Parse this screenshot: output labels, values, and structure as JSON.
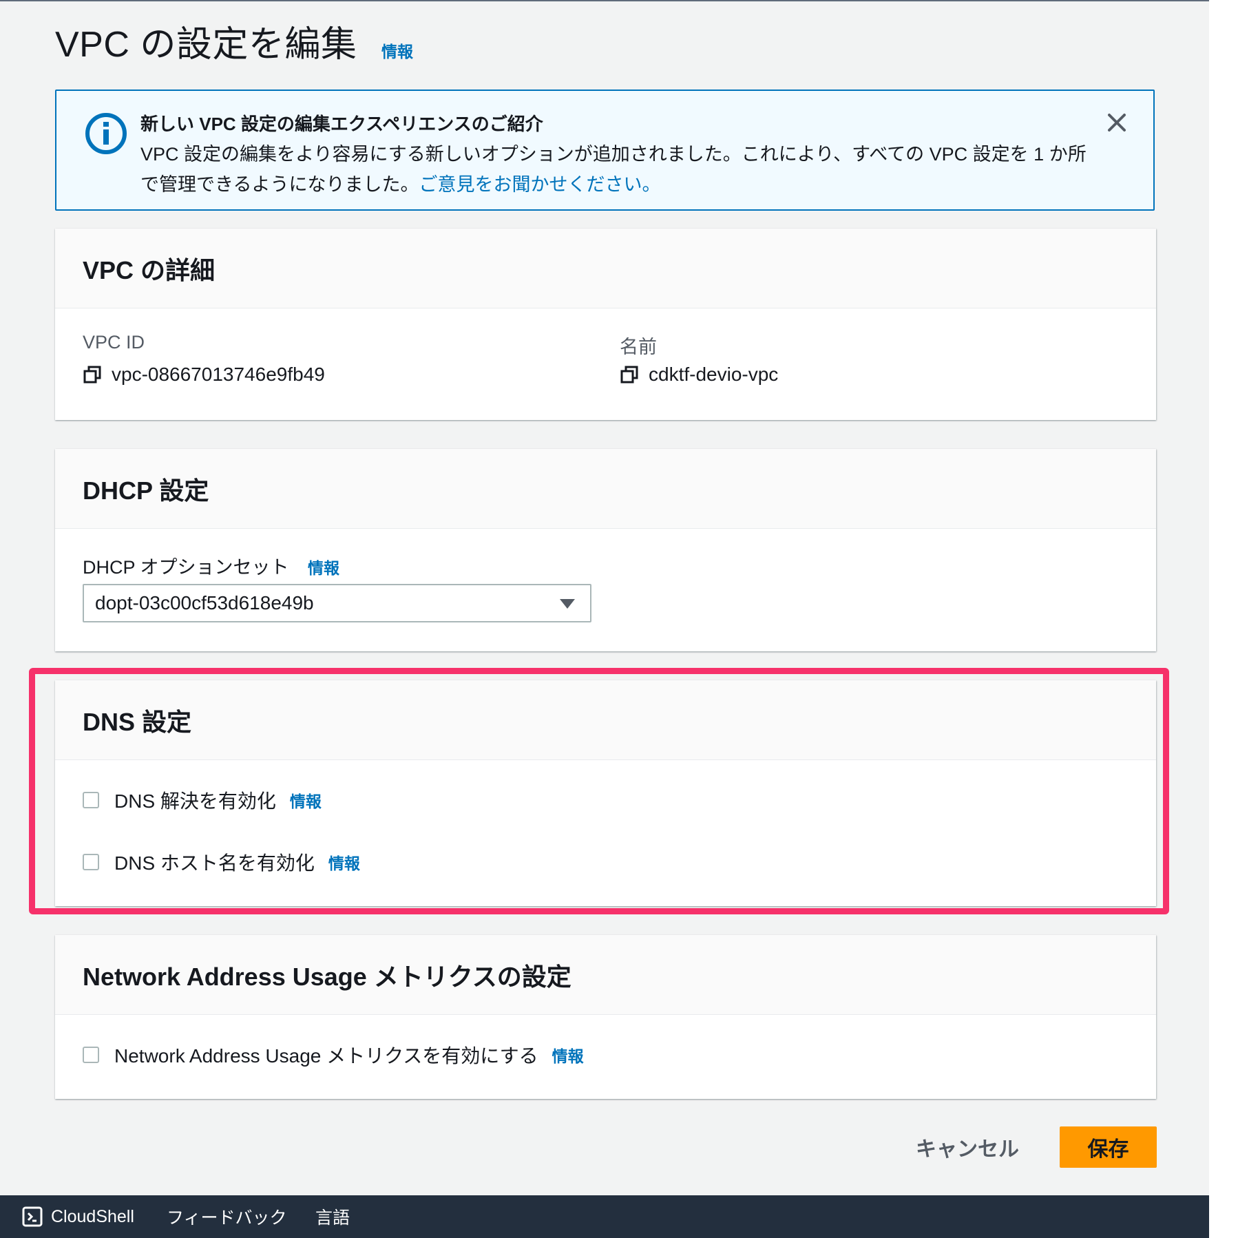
{
  "page": {
    "title": "VPC の設定を編集",
    "info_label": "情報"
  },
  "flash": {
    "title": "新しい VPC 設定の編集エクスペリエンスのご紹介",
    "body": "VPC 設定の編集をより容易にする新しいオプションが追加されました。これにより、すべての VPC 設定を 1 か所で管理できるようになりました。",
    "link": "ご意見をお聞かせください。"
  },
  "vpc_details": {
    "header": "VPC の詳細",
    "vpc_id_label": "VPC ID",
    "vpc_id_value": "vpc-08667013746e9fb49",
    "name_label": "名前",
    "name_value": "cdktf-devio-vpc"
  },
  "dhcp": {
    "header": "DHCP 設定",
    "option_set_label": "DHCP オプションセット",
    "info_label": "情報",
    "selected_value": "dopt-03c00cf53d618e49b"
  },
  "dns": {
    "header": "DNS 設定",
    "resolution_label": "DNS 解決を有効化",
    "hostnames_label": "DNS ホスト名を有効化",
    "info_label": "情報",
    "resolution_checked": false,
    "hostnames_checked": false
  },
  "nau": {
    "header": "Network Address Usage メトリクスの設定",
    "checkbox_label": "Network Address Usage メトリクスを有効にする",
    "info_label": "情報",
    "checked": false
  },
  "actions": {
    "cancel": "キャンセル",
    "save": "保存"
  },
  "footer": {
    "cloudshell": "CloudShell",
    "feedback": "フィードバック",
    "language": "言語"
  },
  "colors": {
    "accent": "#0073bb",
    "primary_button": "#ff9900",
    "highlight": "#f6316a",
    "footer_bg": "#232f3e"
  },
  "icons": [
    "info-icon",
    "close-icon",
    "copy-icon",
    "caret-down-icon",
    "cloudshell-icon"
  ]
}
